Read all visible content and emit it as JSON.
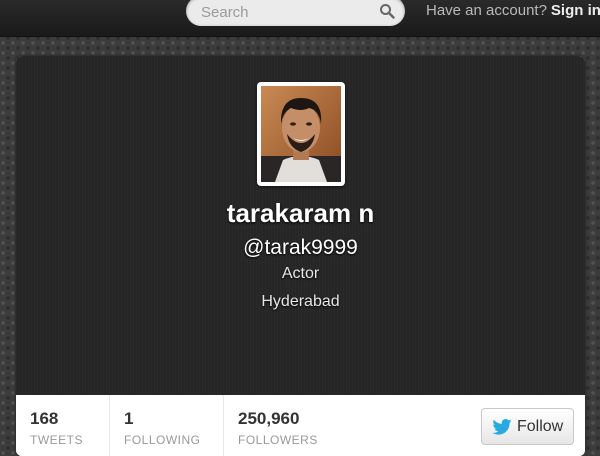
{
  "topbar": {
    "search": {
      "placeholder": "Search",
      "icon": "search-icon"
    },
    "account_prompt": "Have an account?",
    "signin_label": "Sign in"
  },
  "profile": {
    "avatar_icon": "profile-photo",
    "name": "tarakaram n",
    "handle": "@tarak9999",
    "bio": "Actor",
    "location": "Hyderabad"
  },
  "stats": [
    {
      "value": "168",
      "label": "TWEETS"
    },
    {
      "value": "1",
      "label": "FOLLOWING"
    },
    {
      "value": "250,960",
      "label": "FOLLOWERS"
    }
  ],
  "follow_button": {
    "label": "Follow",
    "icon": "twitter-bird-icon",
    "brand_color": "#2aa9e0"
  }
}
